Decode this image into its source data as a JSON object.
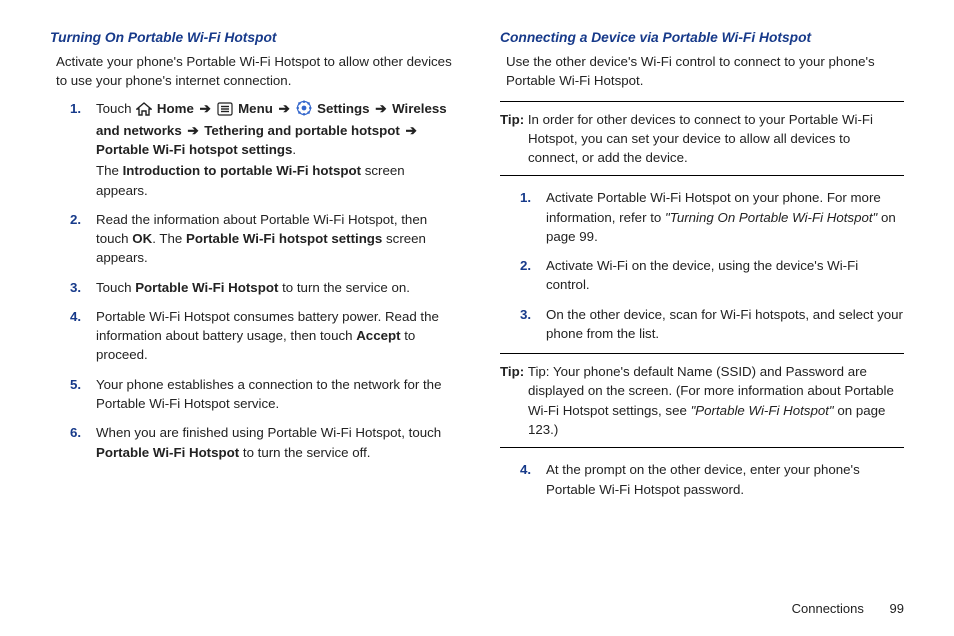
{
  "left": {
    "title": "Turning On Portable Wi-Fi Hotspot",
    "intro": "Activate your phone's Portable Wi-Fi Hotspot to allow other devices to use your phone's internet connection.",
    "step1": {
      "touch": "Touch ",
      "home": " Home ",
      "menu": " Menu ",
      "settings": " Settings ",
      "wireless": "Wireless and networks ",
      "tethering": " Tethering and portable hotspot ",
      "psettings": " Portable Wi-Fi hotspot settings",
      "period": ".",
      "sub_a": "The ",
      "sub_b": "Introduction to portable Wi-Fi hotspot",
      "sub_c": " screen appears."
    },
    "step2": {
      "a": "Read the information about Portable Wi-Fi Hotspot, then touch ",
      "ok": "OK",
      "b": ". The ",
      "settings": "Portable Wi-Fi hotspot settings",
      "c": " screen appears."
    },
    "step3": {
      "a": "Touch ",
      "pwh": "Portable Wi-Fi Hotspot",
      "b": " to turn the service on."
    },
    "step4": {
      "a": "Portable Wi-Fi Hotspot consumes battery power. Read the information about battery usage, then touch ",
      "accept": "Accept",
      "b": " to proceed."
    },
    "step5": "Your phone establishes a connection to the network for the Portable Wi-Fi Hotspot service.",
    "step6": {
      "a": "When you are finished using Portable Wi-Fi Hotspot, touch ",
      "pwh": "Portable Wi-Fi Hotspot",
      "b": " to turn the service off."
    }
  },
  "right": {
    "title": "Connecting a Device via Portable Wi-Fi Hotspot",
    "intro": "Use the other device's Wi-Fi control to connect to your phone's Portable Wi-Fi Hotspot.",
    "tip1_label": "Tip: ",
    "tip1_body": "In order for other devices to connect to your Portable Wi-Fi Hotspot, you can set your device to allow all devices to connect, or add the device.",
    "step1": {
      "a": "Activate Portable Wi-Fi Hotspot on your phone. For more information, refer to ",
      "ref": "\"Turning On Portable Wi-Fi Hotspot\"",
      "b": " on page 99."
    },
    "step2": "Activate Wi-Fi on the device, using the device's Wi-Fi control.",
    "step3": "On the other device, scan for Wi-Fi hotspots, and select your phone from the list.",
    "tip2_label": "Tip: ",
    "tip2_a": "Tip: Your phone's default Name (SSID) and Password are displayed on the screen. (For more information about Portable Wi-Fi Hotspot settings, see ",
    "tip2_ref": "\"Portable Wi-Fi Hotspot\"",
    "tip2_b": " on page 123.)",
    "step4": "At the prompt on the other device, enter your phone's Portable Wi-Fi Hotspot password."
  },
  "footer": {
    "section": "Connections",
    "page": "99"
  },
  "glyphs": {
    "arrow": "➔"
  }
}
